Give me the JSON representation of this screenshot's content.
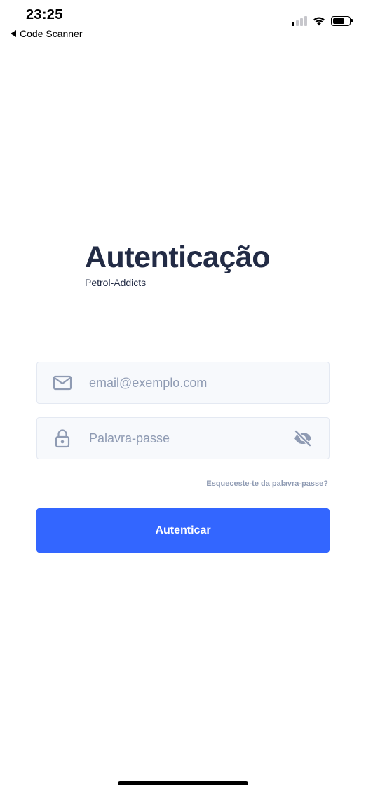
{
  "status_bar": {
    "time": "23:25",
    "back_label": "Code Scanner"
  },
  "header": {
    "title": "Autenticação",
    "subtitle": "Petrol-Addicts"
  },
  "form": {
    "email": {
      "placeholder": "email@exemplo.com",
      "value": "",
      "icon": "email-icon"
    },
    "password": {
      "placeholder": "Palavra-passe",
      "value": "",
      "icon": "lock-icon",
      "toggle_icon": "eye-off-icon"
    },
    "forgot_label": "Esqueceste-te da palavra-passe?",
    "submit_label": "Autenticar"
  },
  "colors": {
    "primary": "#3366ff",
    "text": "#222b45",
    "hint": "#8f9bb3",
    "input_bg": "#f7f9fc",
    "input_border": "#e4e9f2"
  }
}
